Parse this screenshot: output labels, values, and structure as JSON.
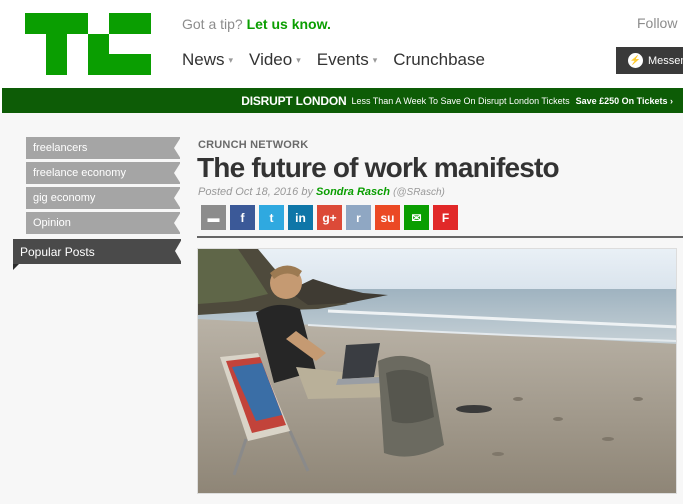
{
  "header": {
    "tip_text": "Got a tip?",
    "tip_link": "Let us know.",
    "follow_label": "Follow",
    "nav": [
      {
        "label": "News",
        "has_dropdown": true
      },
      {
        "label": "Video",
        "has_dropdown": true
      },
      {
        "label": "Events",
        "has_dropdown": true
      },
      {
        "label": "Crunchbase",
        "has_dropdown": false
      }
    ],
    "messenger_label": "Messenger",
    "logo_color": "#0a9e01"
  },
  "banner": {
    "event": "DISRUPT LONDON",
    "description": "Less Than A Week To Save On Disrupt London Tickets",
    "cta": "Save £250 On Tickets ›",
    "color": "#0d5c06"
  },
  "tags": [
    {
      "label": "freelancers"
    },
    {
      "label": "freelance economy"
    },
    {
      "label": "gig economy"
    },
    {
      "label": "Opinion"
    }
  ],
  "popular_label": "Popular Posts",
  "article": {
    "network": "CRUNCH NETWORK",
    "title": "The future of work manifesto",
    "posted": "Posted Oct 18, 2016 by",
    "author": "Sondra Rasch",
    "handle": "(@SRasch)"
  },
  "share_buttons": [
    {
      "name": "comment-icon",
      "glyph": "▬",
      "color": "#8c8c8c"
    },
    {
      "name": "facebook-icon",
      "glyph": "f",
      "color": "#3b5998"
    },
    {
      "name": "twitter-icon",
      "glyph": "t",
      "color": "#2fa9e0"
    },
    {
      "name": "linkedin-icon",
      "glyph": "in",
      "color": "#0e76a8"
    },
    {
      "name": "googleplus-icon",
      "glyph": "g+",
      "color": "#dc4a38"
    },
    {
      "name": "reddit-icon",
      "glyph": "r",
      "color": "#8fa7c3"
    },
    {
      "name": "stumbleupon-icon",
      "glyph": "su",
      "color": "#eb4924"
    },
    {
      "name": "email-icon",
      "glyph": "✉",
      "color": "#0a9e01"
    },
    {
      "name": "flipboard-icon",
      "glyph": "F",
      "color": "#e12828"
    }
  ]
}
